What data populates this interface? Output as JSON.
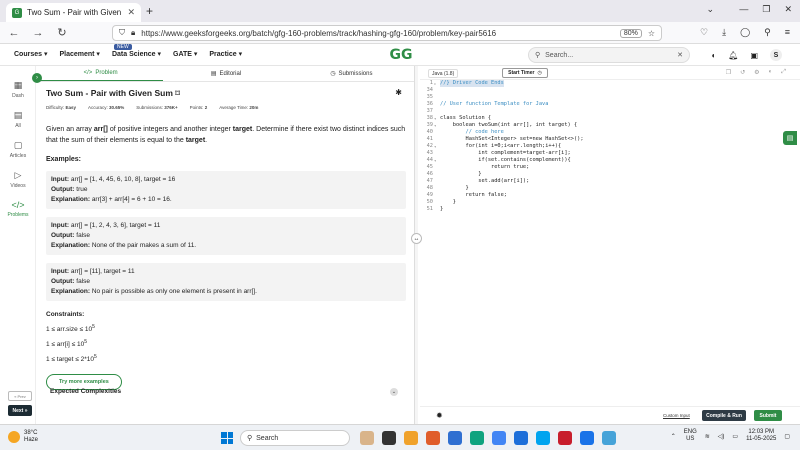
{
  "browser": {
    "tab_title": "Two Sum - Pair with Given Sum",
    "url": "https://www.geeksforgeeks.org/batch/gfg-160-problems/track/hashing-gfg-160/problem/key-pair5616",
    "zoom": "80%"
  },
  "gfg_header": {
    "menu": [
      "Courses ▾",
      "Placement ▾",
      "Data Science ▾",
      "GATE ▾",
      "Practice ▾"
    ],
    "new_badge": "NEW",
    "logo": "GG",
    "search_placeholder": "Search...",
    "avatar": "S"
  },
  "rail": {
    "items": [
      {
        "label": "Dash",
        "icon": "▦"
      },
      {
        "label": "All",
        "icon": "▤"
      },
      {
        "label": "Articles",
        "icon": "▢"
      },
      {
        "label": "Videos",
        "icon": "▷"
      },
      {
        "label": "Problems",
        "icon": "</>"
      }
    ],
    "prev": "« Prev",
    "next": "Next »"
  },
  "problem_tabs": [
    "Problem",
    "Editorial",
    "Submissions"
  ],
  "problem": {
    "title": "Two Sum - Pair with Given Sum",
    "meta": {
      "difficulty_label": "Difficulty:",
      "difficulty": "Easy",
      "accuracy_label": "Accuracy:",
      "accuracy": "30.65%",
      "submissions_label": "Submissions:",
      "submissions": "376K+",
      "points_label": "Points:",
      "points": "2",
      "avg_time_label": "Average Time:",
      "avg_time": "20m"
    },
    "desc_1": "Given an array ",
    "desc_arr": "arr[]",
    "desc_2": " of positive integers and another integer ",
    "desc_target": "target",
    "desc_3": ". Determine if there exist two distinct indices such that the sum of their elements is equal to the ",
    "desc_target2": "target",
    "desc_4": ".",
    "examples_heading": "Examples:",
    "examples": [
      {
        "input": " arr[] = [1, 4, 45, 6, 10, 8], target = 16",
        "output": " true",
        "explanation": " arr[3] + arr[4] = 6 + 10 = 16."
      },
      {
        "input": " arr[] = [1, 2, 4, 3, 6], target = 11",
        "output": " false",
        "explanation": " None of the pair makes a sum of 11."
      },
      {
        "input": " arr[] = [11], target = 11",
        "output": " false",
        "explanation": " No pair is possible as only one element is present in arr[]."
      }
    ],
    "input_label": "Input:",
    "output_label": "Output:",
    "explanation_label": "Explanation:",
    "constraints_heading": "Constraints:",
    "constraints": [
      {
        "text": "1 ≤ arr.size ≤ 10",
        "sup": "5"
      },
      {
        "text": "1 ≤ arr[i] ≤ 10",
        "sup": "5"
      },
      {
        "text": "1 ≤ target ≤ 2*10",
        "sup": "5"
      }
    ],
    "try_more": "Try more examples",
    "expected": "Expected Complexities"
  },
  "editor": {
    "language": "Java (1.8)",
    "start_timer": "Start Timer",
    "lines": [
      {
        "n": "1",
        "fold": "▸",
        "t": "//} Driver Code Ends",
        "cls": "cm",
        "hl": true
      },
      {
        "n": "34",
        "fold": "",
        "t": "",
        "cls": ""
      },
      {
        "n": "35",
        "fold": "",
        "t": "",
        "cls": ""
      },
      {
        "n": "36",
        "fold": "",
        "t": "// User function Template for Java",
        "cls": "cm"
      },
      {
        "n": "37",
        "fold": "",
        "t": "",
        "cls": ""
      },
      {
        "n": "38",
        "fold": "▾",
        "t": "class Solution {",
        "cls": ""
      },
      {
        "n": "39",
        "fold": "▾",
        "t": "    boolean twoSum(int arr[], int target) {",
        "cls": ""
      },
      {
        "n": "40",
        "fold": "",
        "t": "        // code here",
        "cls": "cm"
      },
      {
        "n": "41",
        "fold": "",
        "t": "        HashSet<Integer> set=new HashSet<>();",
        "cls": ""
      },
      {
        "n": "42",
        "fold": "▾",
        "t": "        for(int i=0;i<arr.length;i++){",
        "cls": ""
      },
      {
        "n": "43",
        "fold": "",
        "t": "            int complement=target-arr[i];",
        "cls": ""
      },
      {
        "n": "44",
        "fold": "▾",
        "t": "            if(set.contains(complement)){",
        "cls": ""
      },
      {
        "n": "45",
        "fold": "",
        "t": "                return true;",
        "cls": ""
      },
      {
        "n": "46",
        "fold": "",
        "t": "            }",
        "cls": ""
      },
      {
        "n": "47",
        "fold": "",
        "t": "            set.add(arr[i]);",
        "cls": ""
      },
      {
        "n": "48",
        "fold": "",
        "t": "        }",
        "cls": ""
      },
      {
        "n": "49",
        "fold": "",
        "t": "        return false;",
        "cls": ""
      },
      {
        "n": "50",
        "fold": "",
        "t": "    }",
        "cls": ""
      },
      {
        "n": "51",
        "fold": "",
        "t": "}",
        "cls": ""
      }
    ],
    "custom_input": "Custom Input",
    "compile_run": "Compile & Run",
    "submit": "Submit"
  },
  "taskbar": {
    "temp": "38°C",
    "condition": "Haze",
    "search": "Search",
    "lang_1": "ENG",
    "lang_2": "US",
    "time": "12:03 PM",
    "date": "11-05-2025"
  }
}
